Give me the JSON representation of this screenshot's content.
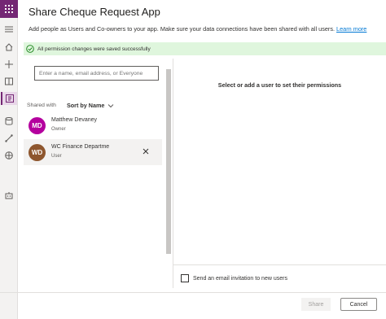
{
  "app": {
    "title": "Share Cheque Request App",
    "subtitle": "Add people as Users and Co-owners to your app. Make sure your data connections have been shared with all users.",
    "learn_more": "Learn more"
  },
  "notification": {
    "message": "All permission changes were saved successfully",
    "icon": "check-circle-icon"
  },
  "left_panel": {
    "search_placeholder": "Enter a name, email address, or Everyone",
    "shared_with_label": "Shared with",
    "sort_label": "Sort by Name",
    "users": [
      {
        "initials": "MD",
        "name": "Matthew Devaney",
        "role": "Owner",
        "avatar_color": "#b4009e"
      },
      {
        "initials": "WD",
        "name": "WC Finance Departme",
        "role": "User",
        "avatar_color": "#8e562e"
      }
    ]
  },
  "right_panel": {
    "placeholder": "Select or add a user to set their permissions",
    "email_invite_label": "Send an email invitation to new users"
  },
  "footer": {
    "share_label": "Share",
    "cancel_label": "Cancel"
  },
  "rail": {
    "accent": "#742774",
    "icons": [
      "waffle-icon",
      "hamburger-icon",
      "home-icon",
      "plus-icon",
      "book-icon",
      "apps-icon",
      "data-icon",
      "flow-icon",
      "globe-icon",
      "bot-icon"
    ]
  }
}
